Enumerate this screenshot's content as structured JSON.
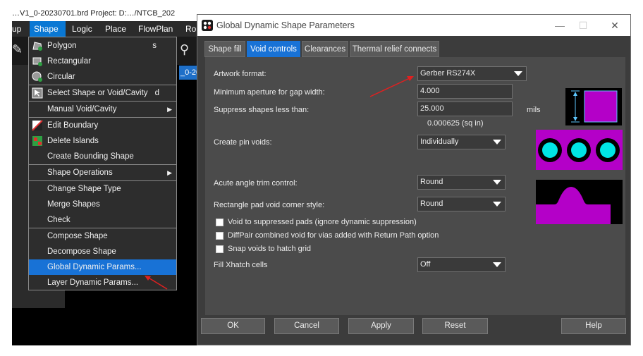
{
  "background_window": {
    "title_fragment": "…V1_0-20230701.brd   Project: D:…/NTCB_202",
    "menu": [
      {
        "label": "up"
      },
      {
        "label": "Shape"
      },
      {
        "label": "Logic"
      },
      {
        "label": "Place"
      },
      {
        "label": "FlowPlan"
      },
      {
        "label": "Ro"
      }
    ],
    "tab_fragment": "_0-20"
  },
  "shape_menu": {
    "items": [
      {
        "label": "Polygon",
        "shortcut": "s",
        "icon": "polygon-icon"
      },
      {
        "label": "Rectangular",
        "icon": "rectangle-icon"
      },
      {
        "label": "Circular",
        "icon": "circle-icon"
      },
      {
        "label": "Select Shape or Void/Cavity",
        "shortcut": "d",
        "icon": "select-shape-icon"
      },
      {
        "label": "Manual Void/Cavity",
        "submenu": "▶"
      },
      {
        "label": "Edit Boundary",
        "icon": "edit-boundary-icon"
      },
      {
        "label": "Delete Islands",
        "icon": "delete-islands-icon"
      },
      {
        "label": "Create Bounding Shape"
      },
      {
        "label": "Shape Operations",
        "submenu": "▶"
      },
      {
        "label": "Change Shape Type"
      },
      {
        "label": "Merge Shapes"
      },
      {
        "label": "Check"
      },
      {
        "label": "Compose Shape"
      },
      {
        "label": "Decompose Shape"
      },
      {
        "label": "Global Dynamic Params..."
      },
      {
        "label": "Layer Dynamic Params..."
      }
    ]
  },
  "dialog": {
    "title": "Global Dynamic Shape Parameters",
    "window_buttons": {
      "minimize": "—",
      "maximize": "☐",
      "close": "✕"
    },
    "tabs": [
      {
        "label": "Shape fill"
      },
      {
        "label": "Void controls"
      },
      {
        "label": "Clearances"
      },
      {
        "label": "Thermal relief connects"
      }
    ],
    "artwork_format": {
      "label": "Artwork format:",
      "value": "Gerber RS274X"
    },
    "min_aperture": {
      "label": "Minimum aperture for gap width:",
      "value": "4.000"
    },
    "suppress_shapes": {
      "label": "Suppress shapes less than:",
      "value": "25.000",
      "unit": "mils",
      "area": "0.000625 (sq in)"
    },
    "pin_voids": {
      "label": "Create pin voids:",
      "value": "Individually"
    },
    "acute_angle": {
      "label": "Acute angle trim control:",
      "value": "Round"
    },
    "rect_pad_corner": {
      "label": "Rectangle pad void corner style:",
      "value": "Round"
    },
    "checkboxes": [
      {
        "label": "Void to suppressed pads (ignore dynamic suppression)",
        "checked": false
      },
      {
        "label": "DiffPair combined void for vias added with Return Path option",
        "checked": false
      },
      {
        "label": "Snap voids to hatch grid",
        "checked": false
      }
    ],
    "fill_xhatch": {
      "label": "Fill Xhatch cells",
      "value": "Off"
    },
    "buttons": [
      {
        "label": "OK"
      },
      {
        "label": "Cancel"
      },
      {
        "label": "Apply"
      },
      {
        "label": "Reset"
      },
      {
        "label": "Help"
      }
    ]
  },
  "colors": {
    "accent": "#1872d6",
    "preview_magenta": "#b400c8",
    "preview_cyan": "#00e5e5"
  }
}
